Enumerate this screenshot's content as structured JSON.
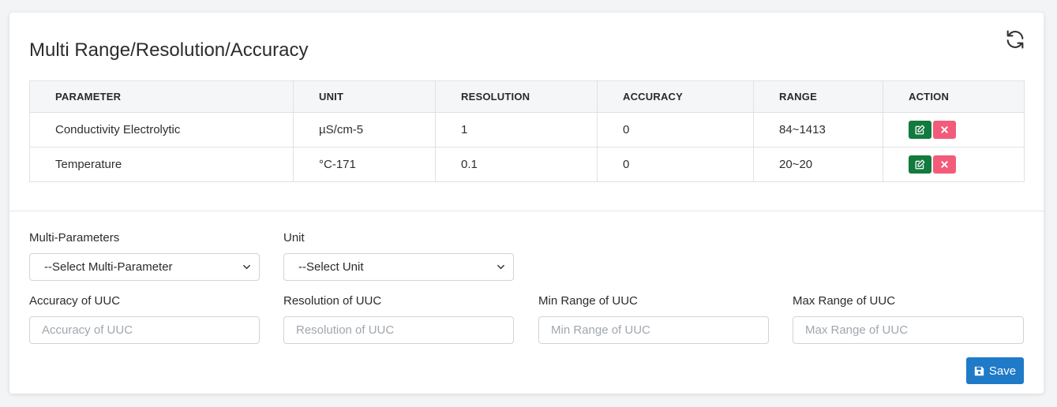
{
  "page": {
    "title": "Multi Range/Resolution/Accuracy"
  },
  "table": {
    "headers": [
      "PARAMETER",
      "UNIT",
      "RESOLUTION",
      "ACCURACY",
      "RANGE",
      "ACTION"
    ],
    "rows": [
      {
        "parameter": "Conductivity Electrolytic",
        "unit": "µS/cm-5",
        "resolution": "1",
        "accuracy": "0",
        "range": "84~1413"
      },
      {
        "parameter": "Temperature",
        "unit": "°C-171",
        "resolution": "0.1",
        "accuracy": "0",
        "range": "20~20"
      }
    ]
  },
  "form": {
    "multi_parameters_label": "Multi-Parameters",
    "multi_parameters_value": "--Select Multi-Parameter",
    "unit_label": "Unit",
    "unit_value": "--Select Unit",
    "accuracy_label": "Accuracy of UUC",
    "accuracy_placeholder": "Accuracy of UUC",
    "resolution_label": "Resolution of UUC",
    "resolution_placeholder": "Resolution of UUC",
    "min_range_label": "Min Range of UUC",
    "min_range_placeholder": "Min Range of UUC",
    "max_range_label": "Max Range of UUC",
    "max_range_placeholder": "Max Range of UUC",
    "save_label": "Save"
  },
  "icons": {
    "refresh": "refresh-icon",
    "edit": "edit-icon",
    "delete": "close-icon",
    "save": "floppy-disk-icon",
    "chevron": "chevron-down-icon"
  },
  "colors": {
    "edit_button": "#127a3e",
    "delete_button": "#f25c7a",
    "save_button": "#1f7bc8"
  }
}
